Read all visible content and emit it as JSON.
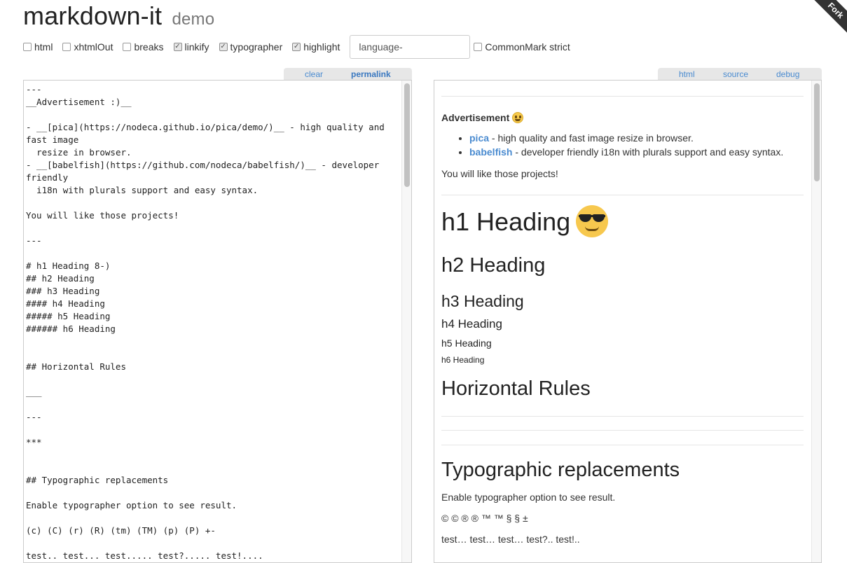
{
  "app": {
    "title": "markdown-it",
    "subtitle": "demo",
    "ribbon": "Fork"
  },
  "options": {
    "html": {
      "label": "html",
      "checked": false
    },
    "xhtmlOut": {
      "label": "xhtmlOut",
      "checked": false
    },
    "breaks": {
      "label": "breaks",
      "checked": false
    },
    "linkify": {
      "label": "linkify",
      "checked": true
    },
    "typographer": {
      "label": "typographer",
      "checked": true
    },
    "highlight": {
      "label": "highlight",
      "checked": true
    },
    "langPrefix": {
      "value": "language-"
    },
    "commonmark": {
      "label": "CommonMark strict",
      "checked": false
    }
  },
  "source_tabs": {
    "clear": "clear",
    "permalink": "permalink"
  },
  "result_tabs": {
    "html": "html",
    "source": "source",
    "debug": "debug"
  },
  "source_text": "---\n__Advertisement :)__\n\n- __[pica](https://nodeca.github.io/pica/demo/)__ - high quality and fast image\n  resize in browser.\n- __[babelfish](https://github.com/nodeca/babelfish/)__ - developer friendly\n  i18n with plurals support and easy syntax.\n\nYou will like those projects!\n\n---\n\n# h1 Heading 8-)\n## h2 Heading\n### h3 Heading\n#### h4 Heading\n##### h5 Heading\n###### h6 Heading\n\n\n## Horizontal Rules\n\n___\n\n---\n\n***\n\n\n## Typographic replacements\n\nEnable typographer option to see result.\n\n(c) (C) (r) (R) (tm) (TM) (p) (P) +-\n\ntest.. test... test..... test?..... test!....",
  "preview": {
    "ad_title": "Advertisement",
    "ad_items": [
      {
        "link": "pica",
        "text": " - high quality and fast image resize in browser."
      },
      {
        "link": "babelfish",
        "text": " - developer friendly i18n with plurals support and easy syntax."
      }
    ],
    "ad_footer": "You will like those projects!",
    "h1": "h1 Heading",
    "h2": "h2 Heading",
    "h3": "h3 Heading",
    "h4": "h4 Heading",
    "h5": "h5 Heading",
    "h6": "h6 Heading",
    "hr_heading": "Horizontal Rules",
    "typo_heading": "Typographic replacements",
    "typo_note": "Enable typographer option to see result.",
    "typo_symbols": "© © ® ® ™ ™ § § ±",
    "typo_tests": "test… test… test… test?.. test!.."
  }
}
